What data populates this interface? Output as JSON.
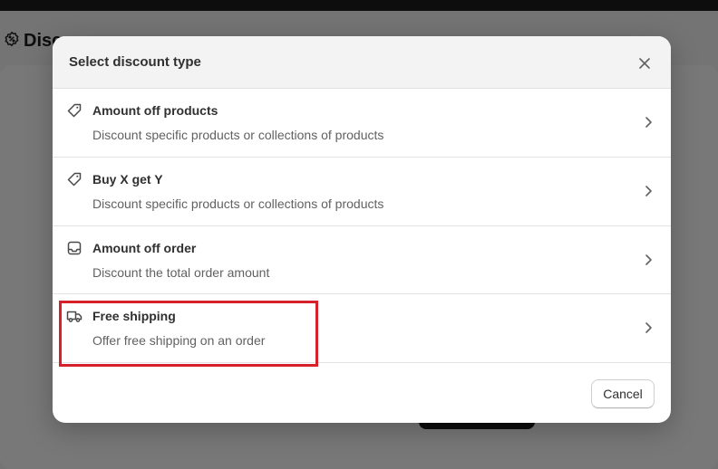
{
  "background": {
    "page_title": "Disco"
  },
  "modal": {
    "title": "Select discount type",
    "options": [
      {
        "icon": "tag-icon",
        "title": "Amount off products",
        "description": "Discount specific products or collections of products"
      },
      {
        "icon": "tag-icon",
        "title": "Buy X get Y",
        "description": "Discount specific products or collections of products"
      },
      {
        "icon": "inbox-icon",
        "title": "Amount off order",
        "description": "Discount the total order amount"
      },
      {
        "icon": "truck-icon",
        "title": "Free shipping",
        "description": "Offer free shipping on an order"
      }
    ],
    "cancel_label": "Cancel"
  },
  "colors": {
    "highlight": "#d6202a",
    "text": "#303030",
    "muted_text": "#616161"
  }
}
